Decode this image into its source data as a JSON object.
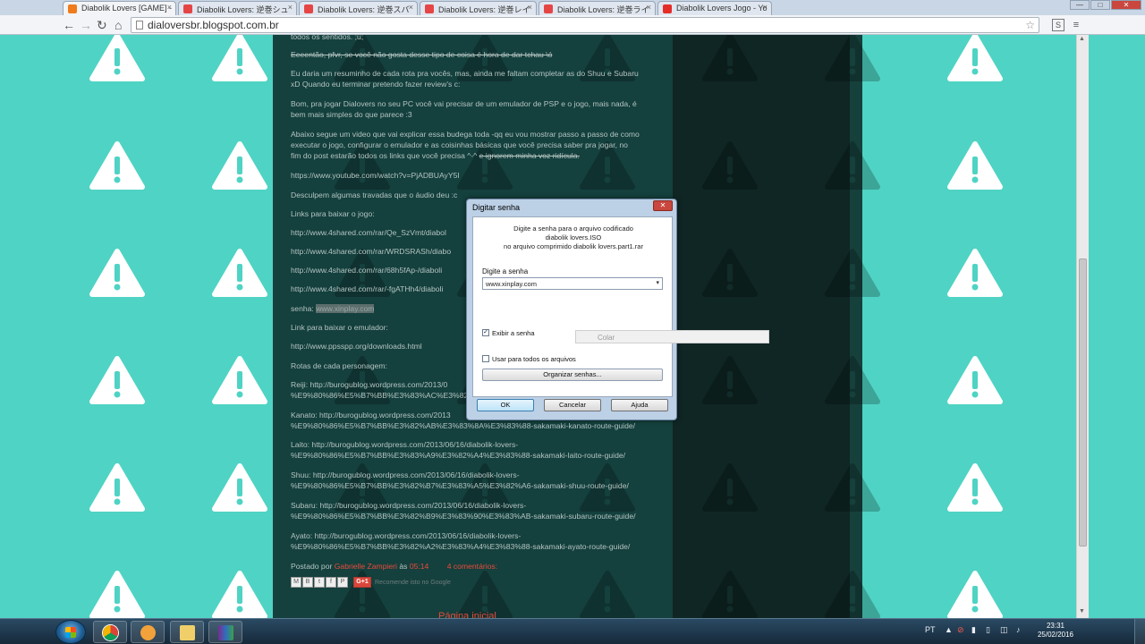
{
  "browser": {
    "tabs": [
      {
        "title": "Diabolik Lovers [GAME] - ",
        "active": true,
        "favicon_color": "#f07b1a"
      },
      {
        "title": "Diabolik Lovers: 逆巻シュ",
        "active": false,
        "favicon_color": "#e64545"
      },
      {
        "title": "Diabolik Lovers: 逆巻スバ",
        "active": false,
        "favicon_color": "#e64545"
      },
      {
        "title": "Diabolik Lovers: 逆巻レイ",
        "active": false,
        "favicon_color": "#e64545"
      },
      {
        "title": "Diabolik Lovers: 逆巻ライ",
        "active": false,
        "favicon_color": "#e64545"
      },
      {
        "title": "Diabolik Lovers Jogo - Yo",
        "active": false,
        "favicon_color": "#e52d27"
      }
    ],
    "url": "dialoversbr.blogspot.com.br",
    "back_glyph": "←",
    "forward_glyph": "→",
    "reload_glyph": "↻",
    "home_glyph": "⌂",
    "star_glyph": "☆",
    "ext_glyph": "S",
    "menu_glyph": "≡",
    "min_glyph": "—",
    "max_glyph": "□",
    "close_glyph": "✕",
    "tab_close_glyph": "×"
  },
  "post": {
    "lines": [
      {
        "text": "todos os sentidos. ;u;",
        "strike": false
      },
      {
        "text": "Eeeentão, pfvr, se você não gosta desse tipo de coisa é hora de dar tchau \\ó",
        "strike": true
      },
      {
        "text": "Eu daria um resuminho de cada rota pra vocês, mas, ainda me faltam completar as do Shuu e Subaru",
        "strike": false
      },
      {
        "text": "xD Quando eu terminar pretendo fazer review's c:",
        "strike": false
      },
      {
        "text": "Bom, pra jogar Dialovers no seu PC você vai precisar de um emulador de PSP e o jogo, mais nada, é",
        "strike": false
      },
      {
        "text": "bem mais simples do que parece :3",
        "strike": false
      },
      {
        "text": "Abaixo segue um video que vai explicar essa budega toda -qq eu vou mostrar passo a passo de como",
        "strike": false
      },
      {
        "text": "executar o jogo, configurar o emulador e as coisinhas básicas que você precisa saber pra jogar, no",
        "strike": false
      },
      {
        "text": "fim do post estarão todos os links que você precisa ^-^",
        "strike": false
      },
      {
        "text": "https://www.youtube.com/watch?v=PjADBUAyY5I",
        "strike": false
      },
      {
        "text": "Desculpem algumas travadas que o áudio deu :c",
        "strike": false
      },
      {
        "text": "Links para baixar o jogo:",
        "strike": false
      },
      {
        "text": "http://www.4shared.com/rar/Qe_SzVmt/diabol",
        "strike": false
      },
      {
        "text": "http://www.4shared.com/rar/WRDSRASh/diabo",
        "strike": false
      },
      {
        "text": "http://www.4shared.com/rar/68h5fAp-/diaboli",
        "strike": false
      },
      {
        "text": "http://www.4shared.com/rar/-fgATHh4/diaboli",
        "strike": false
      },
      {
        "text": "Link para baixar o emulador:",
        "strike": false
      },
      {
        "text": "http://www.ppsspp.org/downloads.html",
        "strike": false
      },
      {
        "text": "Rotas de cada personagem:",
        "strike": false
      },
      {
        "text": "Reiji: http://burogublog.wordpress.com/2013/0",
        "strike": false
      },
      {
        "text": "%E9%80%86%E5%B7%BB%E3%83%AC%E3%82%A4%E",
        "strike": false
      },
      {
        "text": "Kanato: http://burogublog.wordpress.com/2013",
        "strike": false
      },
      {
        "text": "%E9%80%86%E5%B7%BB%E3%82%AB%E3%83%8A%E3%83%88-sakamaki-kanato-route-guide/",
        "strike": false
      },
      {
        "text": "Laito: http://burogublog.wordpress.com/2013/06/16/diabolik-lovers-",
        "strike": false
      },
      {
        "text": "%E9%80%86%E5%B7%BB%E3%83%A9%E3%82%A4%E3%83%88-sakamaki-laito-route-guide/",
        "strike": false
      },
      {
        "text": "Shuu: http://burogublog.wordpress.com/2013/06/16/diabolik-lovers-",
        "strike": false
      },
      {
        "text": "%E9%80%86%E5%B7%BB%E3%82%B7%E3%83%A5%E3%82%A6-sakamaki-shuu-route-guide/",
        "strike": false
      },
      {
        "text": "Subaru: http://burogublog.wordpress.com/2013/06/16/diabolik-lovers-",
        "strike": false
      },
      {
        "text": "%E9%80%86%E5%B7%BB%E3%82%B9%E3%83%90%E3%83%AB-sakamaki-subaru-route-guide/",
        "strike": false
      },
      {
        "text": "Ayato: http://burogublog.wordpress.com/2013/06/16/diabolik-lovers-",
        "strike": false
      },
      {
        "text": "%E9%80%86%E5%B7%BB%E3%82%A2%E3%83%A4%E3%83%88-sakamaki-ayato-route-guide/",
        "strike": false
      }
    ],
    "voice_note": "e ignorem minha voz ridícula.",
    "password_label": "senha:",
    "password_value": "www.xinplay.com",
    "posted_by_prefix": "Postado por",
    "author": "Gabrielle Zampieri",
    "at_word": "às",
    "time": "05:14",
    "comments": "4 comentários:",
    "share_buttons": [
      "M",
      "B",
      "t",
      "f",
      "P"
    ],
    "gplus_label": "G+1",
    "recommend_text": "Recomende isto no Google",
    "home_link": "Página inicial"
  },
  "dialog": {
    "title": "Digitar senha",
    "message_lines": [
      "Digite a senha para o arquivo codificado",
      "diabolik lovers.ISO",
      "no arquivo comprimido diabolik lovers.part1.rar"
    ],
    "password_label": "Digite a senha",
    "password_value": "www.xinplay.com",
    "show_password_label": "Exibir a senha",
    "show_password_checked": true,
    "use_for_all_label": "Usar para todos os arquivos",
    "use_for_all_checked": false,
    "organize_button": "Organizar senhas...",
    "ok_button": "OK",
    "cancel_button": "Cancelar",
    "help_button": "Ajuda",
    "close_glyph": "✕",
    "check_glyph": "✓",
    "dropdown_glyph": "▾"
  },
  "context_menu": {
    "item": "Colar"
  },
  "taskbar": {
    "language": "PT",
    "time": "23:31",
    "date": "25/02/2016",
    "tray_icons": [
      "▲",
      "⊘",
      "▮",
      "▯",
      "◫",
      "♪"
    ]
  },
  "colors": {
    "teal_background": "#4fd3c4",
    "post_panel": "#14403d",
    "link_red": "#e74b3b",
    "warning_icon_white": "#ffffff"
  }
}
